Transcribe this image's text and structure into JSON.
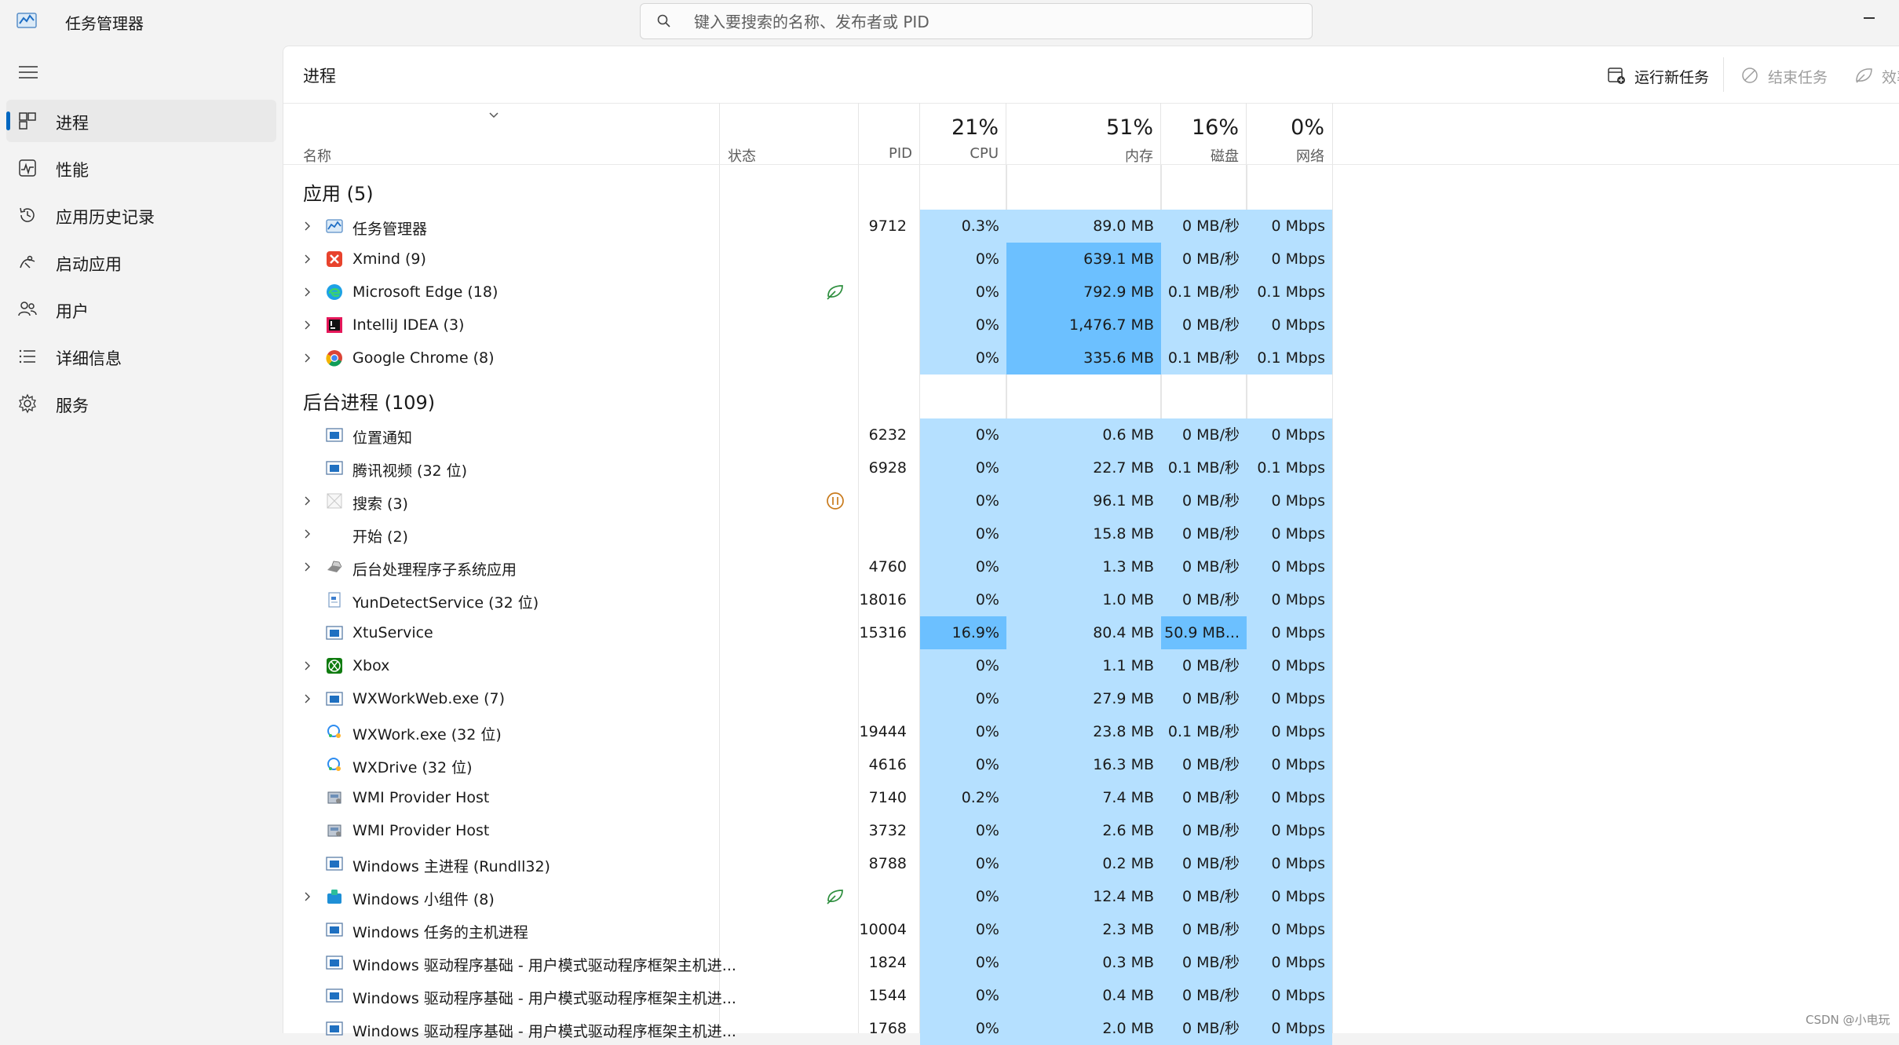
{
  "app": {
    "title": "任务管理器"
  },
  "search": {
    "placeholder": "键入要搜索的名称、发布者或 PID"
  },
  "sidebar": {
    "items": [
      {
        "label": "进程",
        "icon": "processes-icon",
        "active": true
      },
      {
        "label": "性能",
        "icon": "performance-icon"
      },
      {
        "label": "应用历史记录",
        "icon": "app-history-icon"
      },
      {
        "label": "启动应用",
        "icon": "startup-apps-icon"
      },
      {
        "label": "用户",
        "icon": "users-icon"
      },
      {
        "label": "详细信息",
        "icon": "details-icon"
      },
      {
        "label": "服务",
        "icon": "services-icon"
      }
    ]
  },
  "page": {
    "title": "进程"
  },
  "toolbar": {
    "run_new_task": "运行新任务",
    "end_task": "结束任务",
    "efficiency": "效率"
  },
  "columns": {
    "name": "名称",
    "status": "状态",
    "pid": "PID",
    "cpu_pct": "21%",
    "cpu": "CPU",
    "mem_pct": "51%",
    "mem": "内存",
    "disk_pct": "16%",
    "disk": "磁盘",
    "net_pct": "0%",
    "net": "网络"
  },
  "groups": {
    "apps": {
      "title": "应用 (5)",
      "rows": [
        {
          "name": "任务管理器",
          "icon": "task-manager-icon",
          "expand": true,
          "pid": "9712",
          "cpu": "0.3%",
          "mem": "89.0 MB",
          "disk": "0 MB/秒",
          "net": "0 Mbps",
          "mem_hi": false
        },
        {
          "name": "Xmind (9)",
          "icon": "xmind-icon",
          "expand": true,
          "pid": "",
          "cpu": "0%",
          "mem": "639.1 MB",
          "disk": "0 MB/秒",
          "net": "0 Mbps",
          "mem_hi": true
        },
        {
          "name": "Microsoft Edge (18)",
          "icon": "edge-icon",
          "expand": true,
          "status": "efficiency-leaf-icon",
          "pid": "",
          "cpu": "0%",
          "mem": "792.9 MB",
          "disk": "0.1 MB/秒",
          "net": "0.1 Mbps",
          "mem_hi": true
        },
        {
          "name": "IntelliJ IDEA (3)",
          "icon": "intellij-icon",
          "expand": true,
          "pid": "",
          "cpu": "0%",
          "mem": "1,476.7 MB",
          "disk": "0 MB/秒",
          "net": "0 Mbps",
          "mem_hi": true
        },
        {
          "name": "Google Chrome (8)",
          "icon": "chrome-icon",
          "expand": true,
          "pid": "",
          "cpu": "0%",
          "mem": "335.6 MB",
          "disk": "0.1 MB/秒",
          "net": "0.1 Mbps",
          "mem_hi": true
        }
      ]
    },
    "background": {
      "title": "后台进程 (109)",
      "rows": [
        {
          "name": "位置通知",
          "icon": "window-app-icon",
          "expand": false,
          "pid": "6232",
          "cpu": "0%",
          "mem": "0.6 MB",
          "disk": "0 MB/秒",
          "net": "0 Mbps"
        },
        {
          "name": "腾讯视频 (32 位)",
          "icon": "window-app-icon",
          "expand": false,
          "pid": "6928",
          "cpu": "0%",
          "mem": "22.7 MB",
          "disk": "0.1 MB/秒",
          "net": "0.1 Mbps"
        },
        {
          "name": "搜索 (3)",
          "icon": "search-app-icon",
          "expand": true,
          "status": "suspended-icon",
          "pid": "",
          "cpu": "0%",
          "mem": "96.1 MB",
          "disk": "0 MB/秒",
          "net": "0 Mbps"
        },
        {
          "name": "开始 (2)",
          "icon": "",
          "expand": true,
          "pid": "",
          "cpu": "0%",
          "mem": "15.8 MB",
          "disk": "0 MB/秒",
          "net": "0 Mbps"
        },
        {
          "name": "后台处理程序子系统应用",
          "icon": "printer-icon",
          "expand": true,
          "pid": "4760",
          "cpu": "0%",
          "mem": "1.3 MB",
          "disk": "0 MB/秒",
          "net": "0 Mbps"
        },
        {
          "name": "YunDetectService (32 位)",
          "icon": "document-app-icon",
          "expand": false,
          "pid": "18016",
          "cpu": "0%",
          "mem": "1.0 MB",
          "disk": "0 MB/秒",
          "net": "0 Mbps"
        },
        {
          "name": "XtuService",
          "icon": "window-app-icon",
          "expand": false,
          "pid": "15316",
          "cpu": "16.9%",
          "mem": "80.4 MB",
          "disk": "50.9 MB...",
          "net": "0 Mbps",
          "cpu_hi": true,
          "disk_hi": true
        },
        {
          "name": "Xbox",
          "icon": "xbox-icon",
          "expand": true,
          "pid": "",
          "cpu": "0%",
          "mem": "1.1 MB",
          "disk": "0 MB/秒",
          "net": "0 Mbps"
        },
        {
          "name": "WXWorkWeb.exe (7)",
          "icon": "window-app-icon",
          "expand": true,
          "pid": "",
          "cpu": "0%",
          "mem": "27.9 MB",
          "disk": "0 MB/秒",
          "net": "0 Mbps"
        },
        {
          "name": "WXWork.exe (32 位)",
          "icon": "wxwork-icon",
          "expand": false,
          "pid": "19444",
          "cpu": "0%",
          "mem": "23.8 MB",
          "disk": "0.1 MB/秒",
          "net": "0 Mbps"
        },
        {
          "name": "WXDrive (32 位)",
          "icon": "wxwork-icon",
          "expand": false,
          "pid": "4616",
          "cpu": "0%",
          "mem": "16.3 MB",
          "disk": "0 MB/秒",
          "net": "0 Mbps"
        },
        {
          "name": "WMI Provider Host",
          "icon": "wmi-host-icon",
          "expand": false,
          "pid": "7140",
          "cpu": "0.2%",
          "mem": "7.4 MB",
          "disk": "0 MB/秒",
          "net": "0 Mbps"
        },
        {
          "name": "WMI Provider Host",
          "icon": "wmi-host-icon",
          "expand": false,
          "pid": "3732",
          "cpu": "0%",
          "mem": "2.6 MB",
          "disk": "0 MB/秒",
          "net": "0 Mbps"
        },
        {
          "name": "Windows 主进程 (Rundll32)",
          "icon": "window-app-icon",
          "expand": false,
          "pid": "8788",
          "cpu": "0%",
          "mem": "0.2 MB",
          "disk": "0 MB/秒",
          "net": "0 Mbps"
        },
        {
          "name": "Windows 小组件 (8)",
          "icon": "widgets-icon",
          "expand": true,
          "status": "efficiency-leaf-icon",
          "pid": "",
          "cpu": "0%",
          "mem": "12.4 MB",
          "disk": "0 MB/秒",
          "net": "0 Mbps"
        },
        {
          "name": "Windows 任务的主机进程",
          "icon": "window-app-icon",
          "expand": false,
          "pid": "10004",
          "cpu": "0%",
          "mem": "2.3 MB",
          "disk": "0 MB/秒",
          "net": "0 Mbps"
        },
        {
          "name": "Windows 驱动程序基础 - 用户模式驱动程序框架主机进...",
          "icon": "window-app-icon",
          "expand": false,
          "pid": "1824",
          "cpu": "0%",
          "mem": "0.3 MB",
          "disk": "0 MB/秒",
          "net": "0 Mbps"
        },
        {
          "name": "Windows 驱动程序基础 - 用户模式驱动程序框架主机进...",
          "icon": "window-app-icon",
          "expand": false,
          "pid": "1544",
          "cpu": "0%",
          "mem": "0.4 MB",
          "disk": "0 MB/秒",
          "net": "0 Mbps"
        },
        {
          "name": "Windows 驱动程序基础 - 用户模式驱动程序框架主机进...",
          "icon": "window-app-icon",
          "expand": false,
          "pid": "1768",
          "cpu": "0%",
          "mem": "2.0 MB",
          "disk": "0 MB/秒",
          "net": "0 Mbps"
        }
      ]
    }
  },
  "colors": {
    "heat_low": "#b5e0ff",
    "heat_high": "#6cc0ff",
    "accent": "#0067c0"
  },
  "watermark": "CSDN @小电玩"
}
